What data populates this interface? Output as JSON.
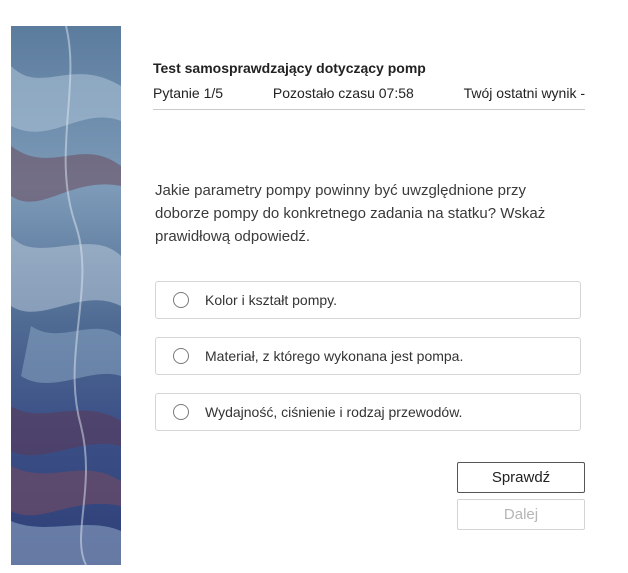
{
  "quiz": {
    "title": "Test samosprawdzający dotyczący pomp",
    "question_counter": "Pytanie 1/5",
    "time_remaining": "Pozostało czasu 07:58",
    "last_score": "Twój ostatni wynik -"
  },
  "question": {
    "text": "Jakie parametry pompy powinny być uwzględnione przy doborze pompy do konkretnego zadania na statku? Wskaż prawidłową odpowiedź.",
    "options": [
      {
        "label": "Kolor i kształt pompy.",
        "selected": false
      },
      {
        "label": "Materiał, z którego wykonana jest pompa.",
        "selected": false
      },
      {
        "label": "Wydajność, ciśnienie i rodzaj przewodów.",
        "selected": false
      }
    ]
  },
  "actions": {
    "check_label": "Sprawdź",
    "next_label": "Dalej",
    "next_enabled": false
  },
  "theme": {
    "accent": "#555555",
    "disabled_text": "#b5b5b5",
    "border": "#d6d6d6"
  }
}
